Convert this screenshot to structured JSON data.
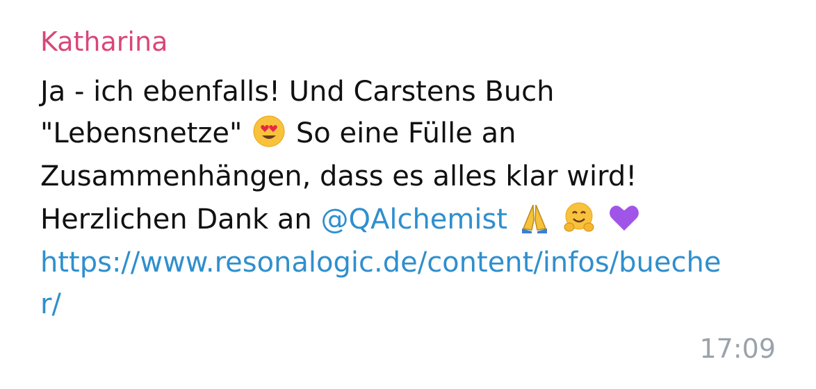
{
  "message": {
    "sender": "Katharina",
    "line1": "Ja - ich ebenfalls! Und Carstens Buch",
    "line2_before": "\"Lebensnetze\"",
    "line2_after": "So eine Fülle an",
    "line3": "Zusammenhängen, dass es alles klar wird!",
    "line4_before": "Herzlichen Dank an",
    "mention": "@QAlchemist",
    "link_line1": "https://www.resonalogic.de/content/infos/bueche",
    "link_line2": "r/",
    "time": "17:09"
  },
  "emojis": [
    "heart-eyes-emoji",
    "folded-hands-emoji",
    "hugging-face-emoji",
    "purple-heart-emoji"
  ],
  "colors": {
    "sender": "#d9467a",
    "link": "#2f8fce",
    "time": "#9aa3ab",
    "text": "#111111"
  }
}
